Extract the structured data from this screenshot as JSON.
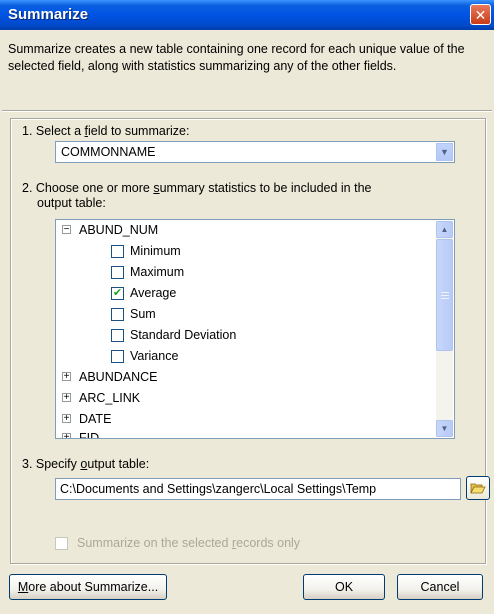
{
  "window": {
    "title": "Summarize",
    "close_label": "✕"
  },
  "description": "Summarize creates a new table containing one record for each unique value of the selected field, along with statistics summarizing any of the other fields.",
  "step1": {
    "label_pre": "1.  Select a ",
    "label_hot": "f",
    "label_post": "ield to summarize:",
    "field_value": "COMMONNAME"
  },
  "step2": {
    "label_line1_pre": "2.  Choose one or more ",
    "label_line1_hot": "s",
    "label_line1_post": "ummary statistics to be included in the",
    "label_line2": "output table:",
    "tree": {
      "expanded_field": "ABUND_NUM",
      "stats": [
        {
          "label": "Minimum",
          "checked": false
        },
        {
          "label": "Maximum",
          "checked": false
        },
        {
          "label": "Average",
          "checked": true
        },
        {
          "label": "Sum",
          "checked": false
        },
        {
          "label": "Standard Deviation",
          "checked": false
        },
        {
          "label": "Variance",
          "checked": false
        }
      ],
      "collapsed_fields": [
        "ABUNDANCE",
        "ARC_LINK",
        "DATE",
        "FID"
      ]
    }
  },
  "step3": {
    "label_pre": "3.  Specify ",
    "label_hot": "o",
    "label_post": "utput table:",
    "output_path": "C:\\Documents and Settings\\zangerc\\Local Settings\\Temp"
  },
  "selected_only": {
    "label_pre": "Summarize on the selected ",
    "label_hot": "r",
    "label_post": "ecords only",
    "checked": false
  },
  "buttons": {
    "more_hot": "M",
    "more_rest": "ore about Summarize...",
    "ok": "OK",
    "cancel": "Cancel"
  }
}
